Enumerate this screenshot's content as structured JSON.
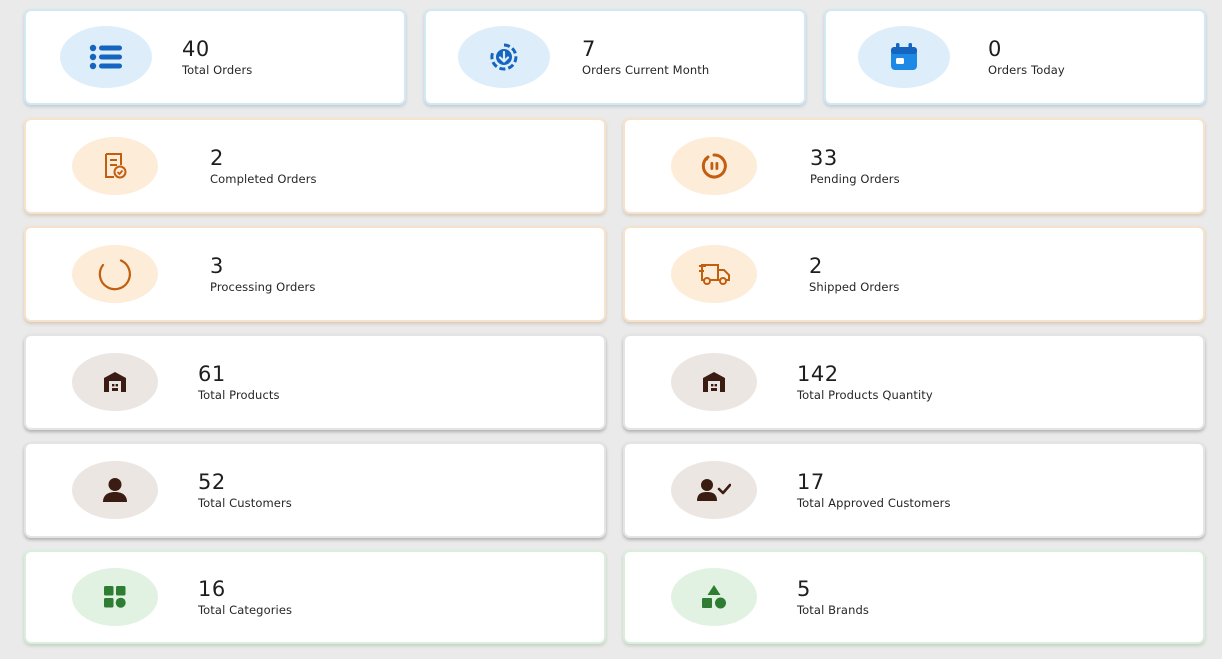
{
  "stats": {
    "total_orders": {
      "value": "40",
      "label": "Total Orders",
      "icon": "list-icon"
    },
    "orders_current_month": {
      "value": "7",
      "label": "Orders Current Month",
      "icon": "download-circle-icon"
    },
    "orders_today": {
      "value": "0",
      "label": "Orders Today",
      "icon": "calendar-icon"
    },
    "completed_orders": {
      "value": "2",
      "label": "Completed Orders",
      "icon": "receipt-check-icon"
    },
    "pending_orders": {
      "value": "33",
      "label": "Pending Orders",
      "icon": "pending-timer-icon"
    },
    "processing_orders": {
      "value": "3",
      "label": "Processing Orders",
      "icon": "spinner-icon"
    },
    "shipped_orders": {
      "value": "2",
      "label": "Shipped Orders",
      "icon": "truck-icon"
    },
    "total_products": {
      "value": "61",
      "label": "Total Products",
      "icon": "warehouse-icon"
    },
    "total_products_qty": {
      "value": "142",
      "label": "Total Products Quantity",
      "icon": "warehouse-icon"
    },
    "total_customers": {
      "value": "52",
      "label": "Total Customers",
      "icon": "user-icon"
    },
    "approved_customers": {
      "value": "17",
      "label": "Total Approved Customers",
      "icon": "user-check-icon"
    },
    "total_categories": {
      "value": "16",
      "label": "Total Categories",
      "icon": "categories-grid-icon"
    },
    "total_brands": {
      "value": "5",
      "label": "Total Brands",
      "icon": "shapes-icon"
    }
  },
  "colors": {
    "page_bg": "#eaeaea",
    "blue_icon": "#1565c0",
    "orange_icon": "#c25e10",
    "brown_icon": "#3a1c12",
    "green_icon": "#2e7d32"
  }
}
